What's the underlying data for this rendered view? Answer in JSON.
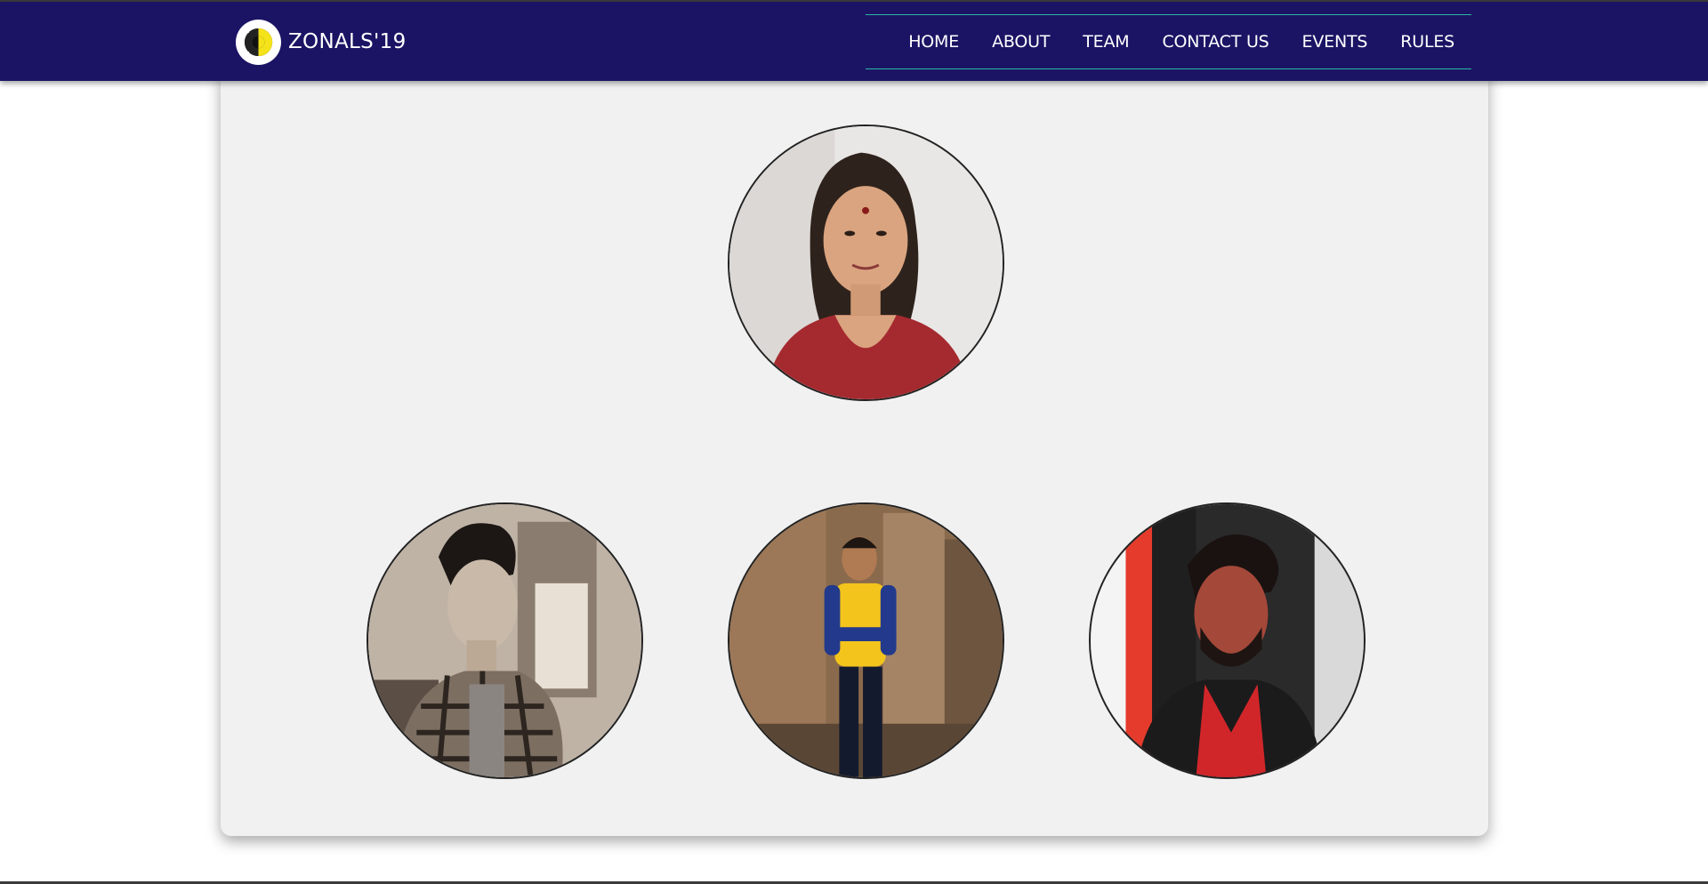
{
  "header": {
    "brand": "ZONALS'19",
    "logo_icon": "zonals-logo-icon",
    "nav": [
      {
        "label": "HOME"
      },
      {
        "label": "ABOUT"
      },
      {
        "label": "TEAM"
      },
      {
        "label": "CONTACT US"
      },
      {
        "label": "EVENTS"
      },
      {
        "label": "RULES"
      }
    ]
  },
  "colors": {
    "navbar_bg": "#1b1464",
    "nav_border": "#2bb8a4",
    "card_bg": "#f1f1f1"
  },
  "team": [
    {
      "photo": "team-member-photo-woman"
    },
    {
      "photo": "team-member-photo-man-sepia"
    },
    {
      "photo": "team-member-photo-man-yellow-shirt"
    },
    {
      "photo": "team-member-photo-man-red-light"
    }
  ]
}
